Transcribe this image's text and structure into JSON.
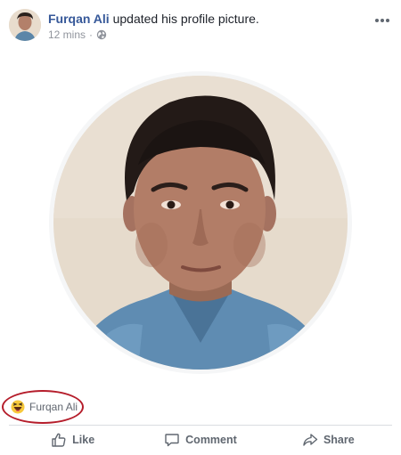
{
  "post": {
    "author": "Furqan Ali",
    "action": "updated his profile picture.",
    "timestamp": "12 mins",
    "separator": "·",
    "privacy_icon": "globe-icon",
    "menu_icon": "more-options-icon"
  },
  "reactions": {
    "icon": "haha-reaction-icon",
    "reactor_name": "Furqan Ali",
    "highlight_color": "#b51d2b"
  },
  "actions": {
    "like_label": "Like",
    "comment_label": "Comment",
    "share_label": "Share"
  },
  "colors": {
    "author_link": "#365899",
    "meta_text": "#90949c",
    "action_text": "#606770"
  }
}
